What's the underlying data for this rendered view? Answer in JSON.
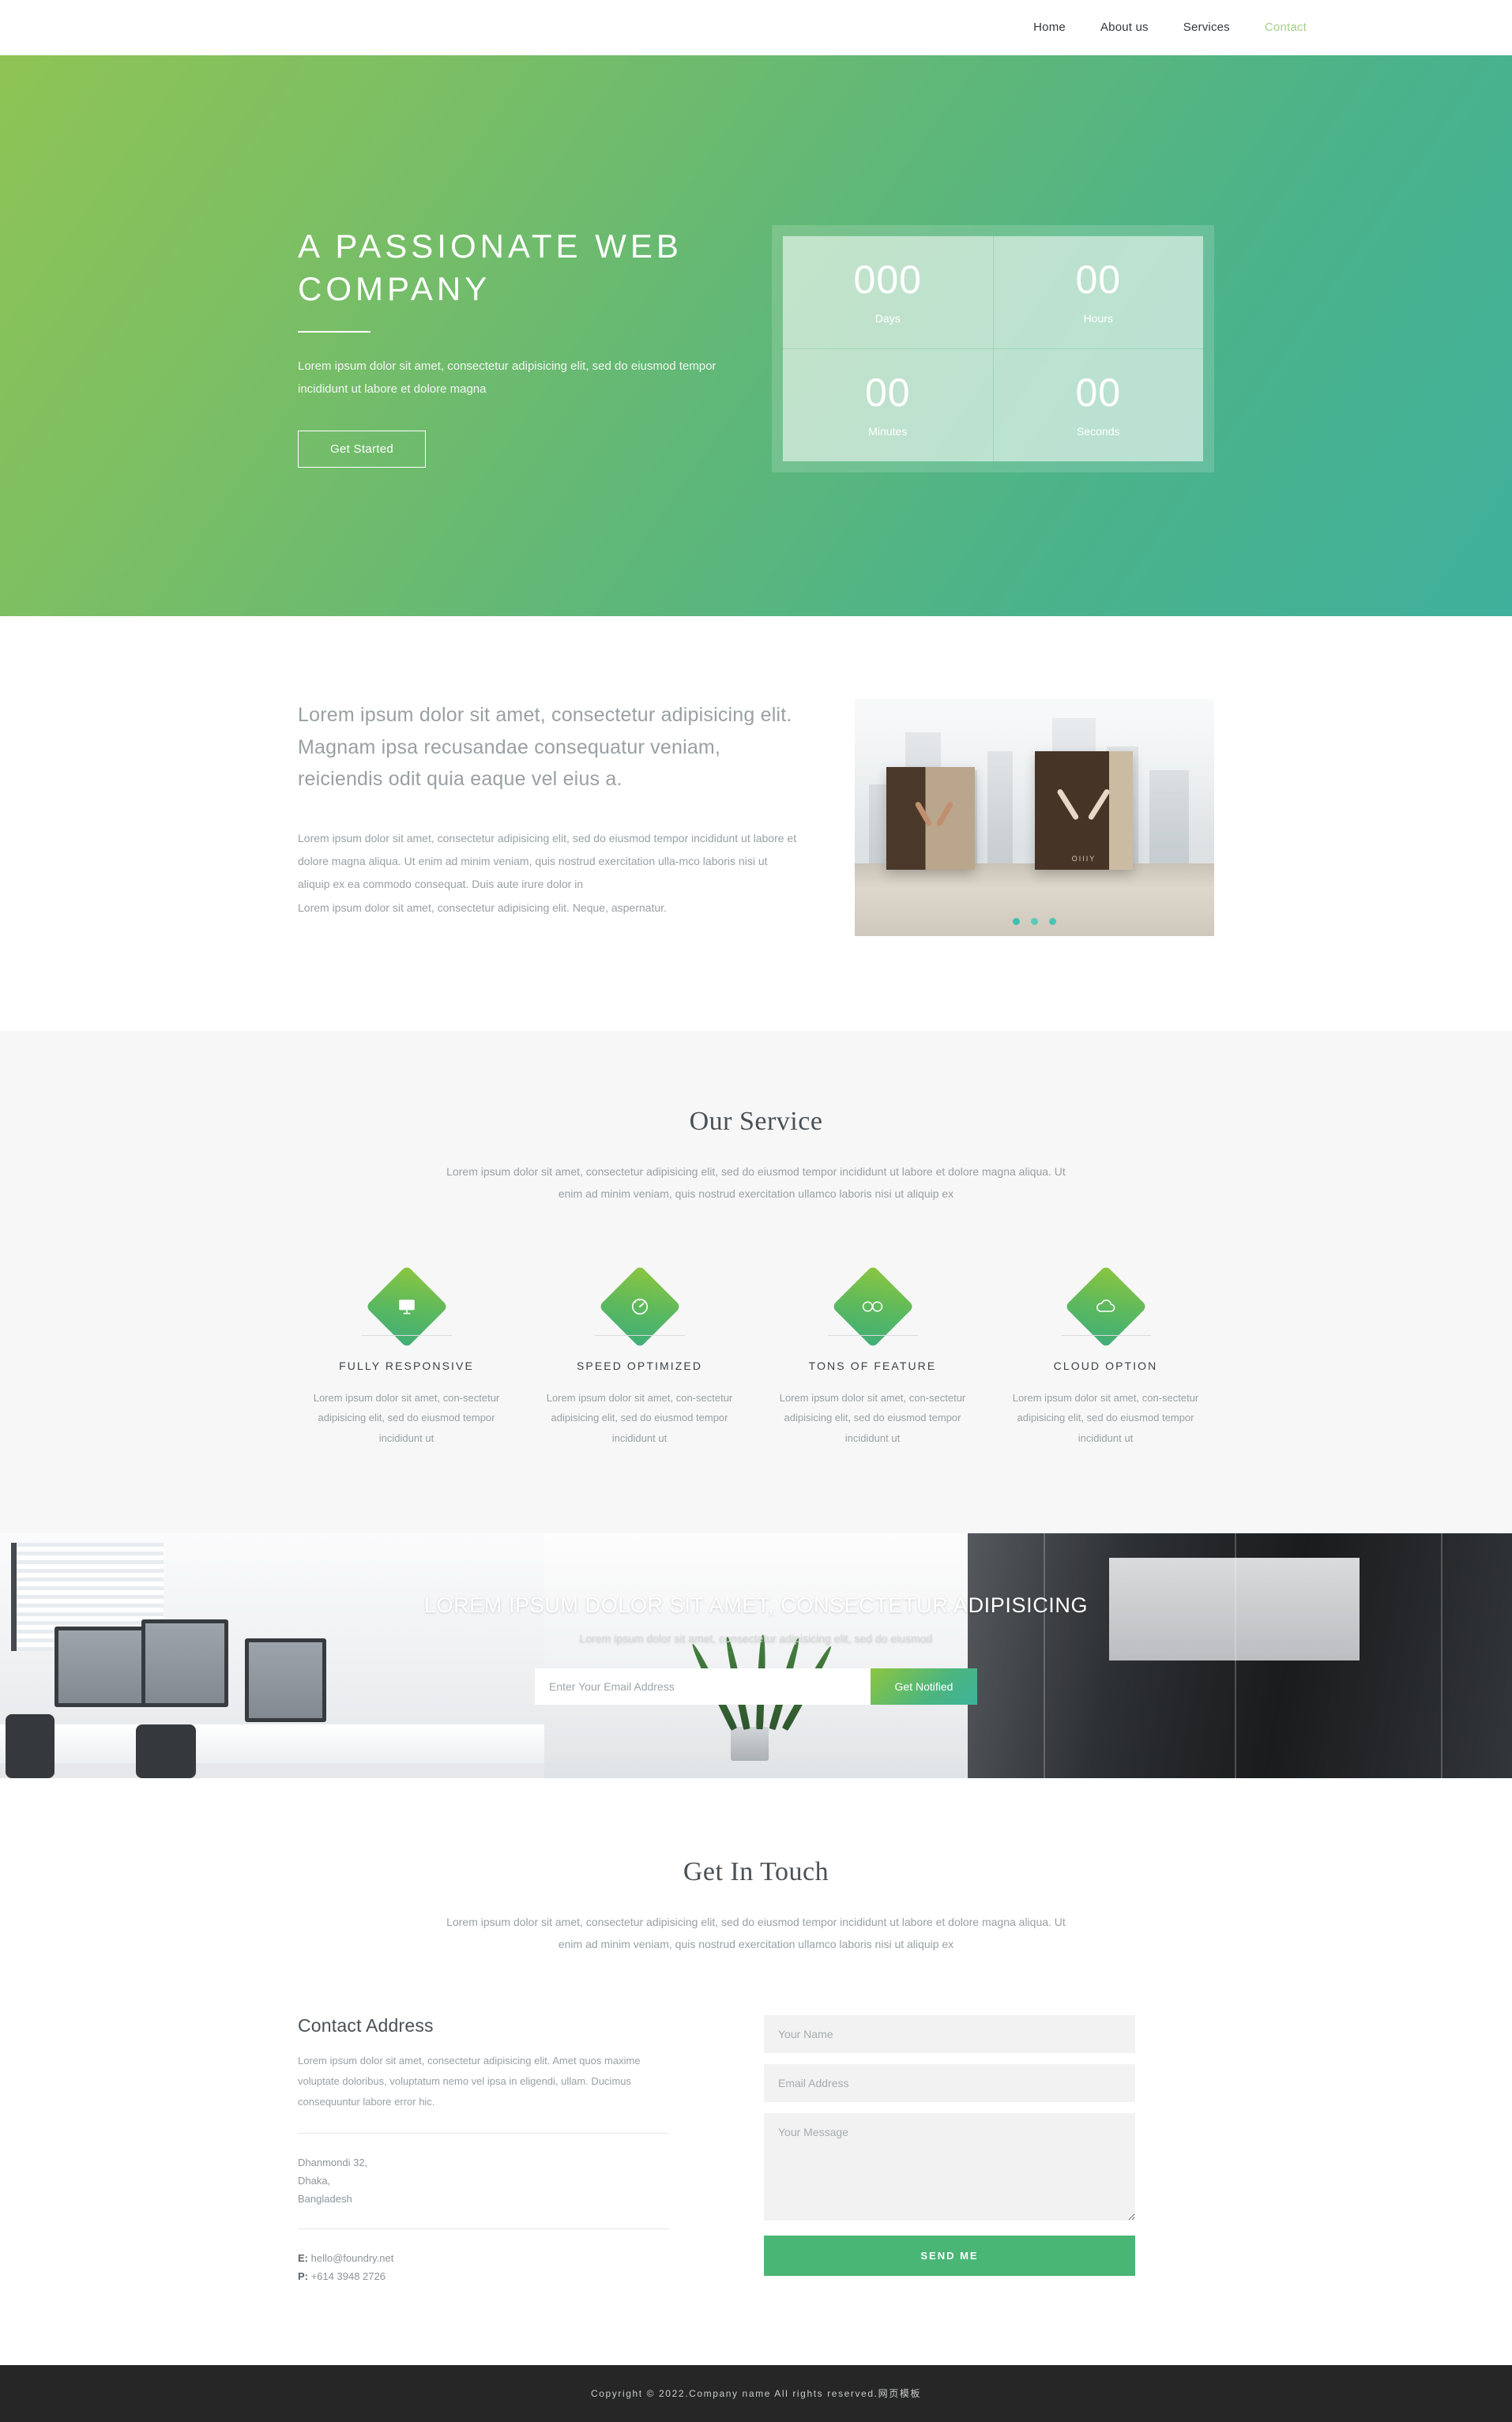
{
  "nav": {
    "items": [
      {
        "label": "Home",
        "active": false
      },
      {
        "label": "About us",
        "active": false
      },
      {
        "label": "Services",
        "active": false
      },
      {
        "label": "Contact",
        "active": true
      }
    ]
  },
  "hero": {
    "title": "A PASSIONATE WEB COMPANY",
    "subtitle": "Lorem ipsum dolor sit amet, consectetur adipisicing elit, sed do eiusmod tempor incididunt ut labore et dolore magna",
    "button_label": "Get Started",
    "gradient_start": "#8fc455",
    "gradient_end": "#3fb09c",
    "countdown": [
      {
        "value": "000",
        "label": "Days"
      },
      {
        "value": "00",
        "label": "Hours"
      },
      {
        "value": "00",
        "label": "Minutes"
      },
      {
        "value": "00",
        "label": "Seconds"
      }
    ]
  },
  "about": {
    "lead": "Lorem ipsum dolor sit amet, consectetur adipisicing elit. Magnam ipsa recusandae consequatur veniam, reiciendis odit quia eaque vel eius a.",
    "paragraph1": "Lorem ipsum dolor sit amet, consectetur adipisicing elit, sed do eiusmod tempor incididunt ut labore et dolore magna aliqua. Ut enim ad minim veniam, quis nostrud exercitation ulla-mco laboris nisi ut aliquip ex ea commodo consequat. Duis aute irure dolor in",
    "paragraph2": "Lorem ipsum dolor sit amet, consectetur adipisicing elit. Neque, aspernatur.",
    "image_caption": "OIIIY",
    "carousel_dot_color": "#3fbfae",
    "carousel_dots": 3
  },
  "services": {
    "title": "Our Service",
    "subtitle": "Lorem ipsum dolor sit amet, consectetur adipisicing elit, sed do eiusmod tempor incididunt ut labore et dolore magna aliqua. Ut enim ad minim veniam, quis nostrud exercitation ullamco laboris nisi ut aliquip ex",
    "badge_gradient_start": "#8cc63f",
    "badge_gradient_end": "#3fae7a",
    "items": [
      {
        "icon": "monitor-icon",
        "title": "FULLY RESPONSIVE",
        "text": "Lorem ipsum dolor sit amet, con-sectetur adipisicing elit, sed do eiusmod tempor incididunt ut"
      },
      {
        "icon": "speedometer-icon",
        "title": "SPEED OPTIMIZED",
        "text": "Lorem ipsum dolor sit amet, con-sectetur adipisicing elit, sed do eiusmod tempor incididunt ut"
      },
      {
        "icon": "infinity-icon",
        "title": "TONS OF FEATURE",
        "text": "Lorem ipsum dolor sit amet, con-sectetur adipisicing elit, sed do eiusmod tempor incididunt ut"
      },
      {
        "icon": "cloud-icon",
        "title": "CLOUD OPTION",
        "text": "Lorem ipsum dolor sit amet, con-sectetur adipisicing elit, sed do eiusmod tempor incididunt ut"
      }
    ]
  },
  "cta": {
    "title": "LOREM IPSUM DOLOR SIT AMET, CONSECTETUR ADIPISICING",
    "subtitle": "Lorem ipsum dolor sit amet, consectetur adipisicing elit, sed do eiusmod",
    "email_placeholder": "Enter Your Email Address",
    "button_label": "Get Notified"
  },
  "contact": {
    "title": "Get In Touch",
    "subtitle": "Lorem ipsum dolor sit amet, consectetur adipisicing elit, sed do eiusmod tempor incididunt ut labore et dolore magna aliqua. Ut enim ad minim veniam, quis nostrud exercitation ullamco laboris nisi ut aliquip ex",
    "address_heading": "Contact Address",
    "address_text": "Lorem ipsum dolor sit amet, consectetur adipisicing elit. Amet quos maxime voluptate doloribus, voluptatum nemo vel ipsa in eligendi, ullam. Ducimus consequuntur labore error hic.",
    "address_line1": "Dhanmondi 32,",
    "address_line2": "Dhaka,",
    "address_line3": "Bangladesh",
    "email_label": "E:",
    "email_value": "hello@foundry.net",
    "phone_label": "P:",
    "phone_value": "+614 3948 2726",
    "form": {
      "name_placeholder": "Your Name",
      "email_placeholder": "Email Address",
      "message_placeholder": "Your Message",
      "submit_label": "SEND ME",
      "submit_color": "#49b675"
    }
  },
  "footer": {
    "text": "Copyright © 2022.Company name All rights reserved.网页模板"
  }
}
